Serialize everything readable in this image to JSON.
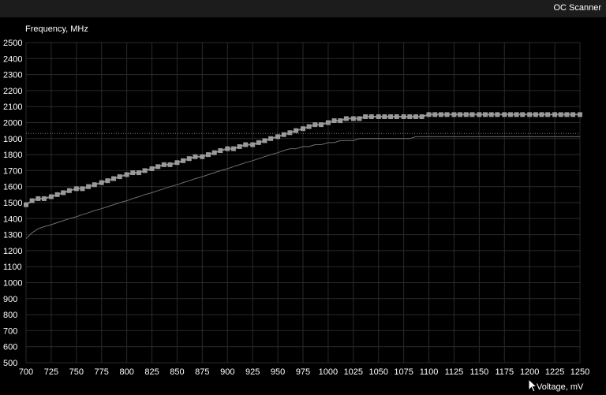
{
  "window": {
    "title": "OC Scanner"
  },
  "colors": {
    "background": "#000000",
    "titlebar": "#1c1c1c",
    "grid": "#2a2a2a",
    "axis_text": "#ffffff",
    "curve_main": "#8a8a8a",
    "curve_marker": "#9a9a9a",
    "curve_secondary": "#6e6e6e",
    "reference_line": "#7a7a7a"
  },
  "chart_data": {
    "type": "line",
    "title": "",
    "ylabel": "Frequency, MHz",
    "xlabel": "Voltage, mV",
    "xlim": [
      700,
      1250
    ],
    "ylim": [
      500,
      2500
    ],
    "grid": true,
    "x_ticks": [
      700,
      725,
      750,
      775,
      800,
      825,
      850,
      875,
      900,
      925,
      950,
      975,
      1000,
      1025,
      1050,
      1075,
      1100,
      1125,
      1150,
      1175,
      1200,
      1225,
      1250
    ],
    "y_ticks": [
      500,
      600,
      700,
      800,
      900,
      1000,
      1100,
      1200,
      1300,
      1400,
      1500,
      1600,
      1700,
      1800,
      1900,
      2000,
      2100,
      2200,
      2300,
      2400,
      2500
    ],
    "reference_line": {
      "y": 1932,
      "style": "dotted"
    },
    "series": [
      {
        "style": "markers",
        "x": [
          700,
          706,
          712,
          718,
          725,
          731,
          737,
          743,
          750,
          756,
          762,
          768,
          775,
          781,
          787,
          793,
          800,
          806,
          812,
          818,
          825,
          831,
          837,
          843,
          850,
          856,
          862,
          868,
          875,
          881,
          887,
          893,
          900,
          906,
          912,
          918,
          925,
          931,
          937,
          943,
          950,
          956,
          962,
          968,
          975,
          981,
          987,
          993,
          1000,
          1006,
          1012,
          1018,
          1025,
          1031,
          1037,
          1043,
          1050,
          1056,
          1062,
          1068,
          1075,
          1081,
          1087,
          1093,
          1100,
          1106,
          1112,
          1118,
          1125,
          1131,
          1137,
          1143,
          1150,
          1156,
          1162,
          1168,
          1175,
          1181,
          1187,
          1193,
          1200,
          1206,
          1212,
          1218,
          1225,
          1231,
          1237,
          1243,
          1250
        ],
        "y": [
          1487,
          1512,
          1525,
          1525,
          1537,
          1550,
          1562,
          1575,
          1587,
          1587,
          1600,
          1612,
          1625,
          1637,
          1650,
          1662,
          1675,
          1687,
          1687,
          1700,
          1712,
          1725,
          1737,
          1737,
          1750,
          1762,
          1775,
          1787,
          1787,
          1800,
          1812,
          1825,
          1837,
          1837,
          1850,
          1862,
          1862,
          1875,
          1887,
          1900,
          1912,
          1925,
          1937,
          1950,
          1962,
          1975,
          1987,
          1987,
          2000,
          2012,
          2012,
          2025,
          2025,
          2025,
          2037,
          2037,
          2037,
          2037,
          2037,
          2037,
          2037,
          2037,
          2037,
          2037,
          2050,
          2050,
          2050,
          2050,
          2050,
          2050,
          2050,
          2050,
          2050,
          2050,
          2050,
          2050,
          2050,
          2050,
          2050,
          2050,
          2050,
          2050,
          2050,
          2050,
          2050,
          2050,
          2050,
          2050,
          2050
        ]
      },
      {
        "style": "thin",
        "x": [
          700,
          706,
          712,
          718,
          725,
          731,
          737,
          743,
          750,
          756,
          762,
          768,
          775,
          781,
          787,
          793,
          800,
          806,
          812,
          818,
          825,
          831,
          837,
          843,
          850,
          856,
          862,
          868,
          875,
          881,
          887,
          893,
          900,
          906,
          912,
          918,
          925,
          931,
          937,
          943,
          950,
          956,
          962,
          968,
          975,
          981,
          987,
          993,
          1000,
          1006,
          1012,
          1018,
          1025,
          1031,
          1037,
          1043,
          1050,
          1056,
          1062,
          1068,
          1075,
          1081,
          1087,
          1093,
          1100,
          1106,
          1112,
          1118,
          1125,
          1131,
          1137,
          1143,
          1150,
          1156,
          1162,
          1168,
          1175,
          1181,
          1187,
          1193,
          1200,
          1206,
          1212,
          1218,
          1225,
          1231,
          1237,
          1243,
          1250
        ],
        "y": [
          1275,
          1312,
          1337,
          1350,
          1362,
          1375,
          1387,
          1400,
          1412,
          1425,
          1437,
          1450,
          1462,
          1475,
          1487,
          1500,
          1512,
          1525,
          1537,
          1550,
          1562,
          1575,
          1587,
          1600,
          1612,
          1625,
          1637,
          1650,
          1662,
          1675,
          1687,
          1700,
          1712,
          1725,
          1737,
          1750,
          1762,
          1775,
          1787,
          1800,
          1812,
          1825,
          1837,
          1837,
          1850,
          1850,
          1862,
          1862,
          1875,
          1875,
          1887,
          1887,
          1887,
          1900,
          1900,
          1900,
          1900,
          1900,
          1900,
          1900,
          1900,
          1900,
          1912,
          1912,
          1912,
          1912,
          1912,
          1912,
          1912,
          1912,
          1912,
          1912,
          1912,
          1912,
          1912,
          1912,
          1912,
          1912,
          1912,
          1912,
          1912,
          1912,
          1912,
          1912,
          1912,
          1912,
          1912,
          1912,
          1912
        ]
      }
    ]
  }
}
